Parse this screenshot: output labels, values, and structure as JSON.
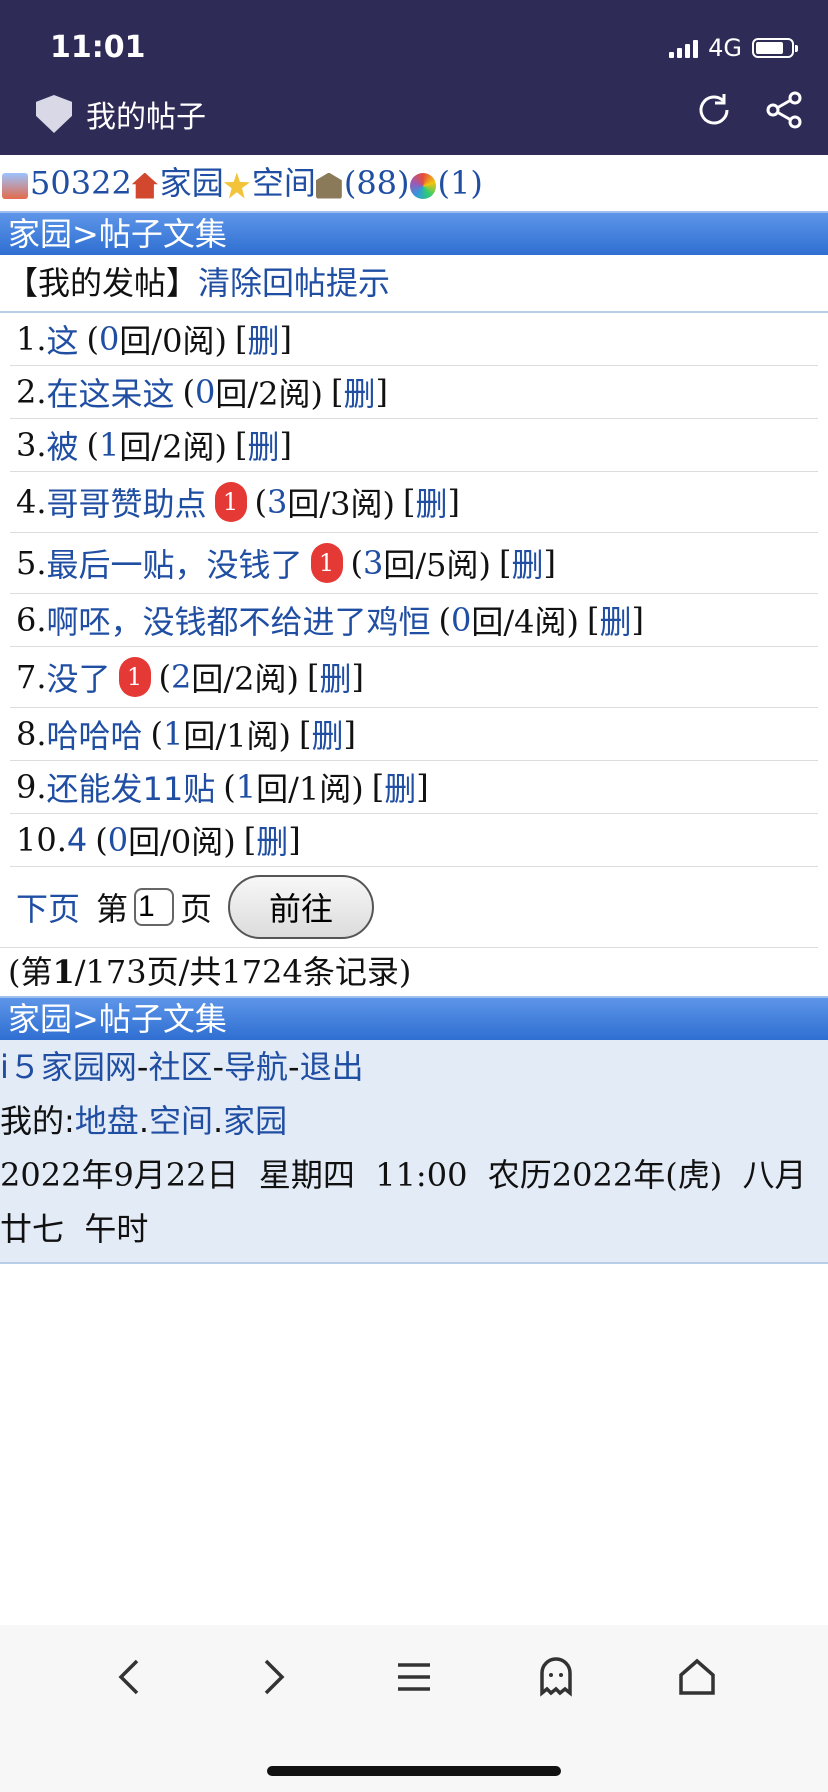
{
  "status": {
    "time": "11:01",
    "network": "4G"
  },
  "browser": {
    "title": "我的帖子"
  },
  "userbar": {
    "uid": "50322",
    "home": "家园",
    "space": "空间",
    "count1": "(88)",
    "count2": "(1)"
  },
  "breadcrumb": "家园>帖子文集",
  "subhead": {
    "mine": "【我的发帖】",
    "clear": "清除回帖提示"
  },
  "posts": [
    {
      "idx": "1.",
      "title": "这",
      "replies": "0",
      "stat": "回/0阅)",
      "badge": "",
      "del": "删"
    },
    {
      "idx": "2.",
      "title": "在这呆这",
      "replies": "0",
      "stat": "回/2阅)",
      "badge": "",
      "del": "删"
    },
    {
      "idx": "3.",
      "title": "被",
      "replies": "1",
      "stat": "回/2阅)",
      "badge": "",
      "del": "删"
    },
    {
      "idx": "4.",
      "title": "哥哥赞助点",
      "replies": "3",
      "stat": "回/3阅)",
      "badge": "1",
      "del": "删"
    },
    {
      "idx": "5.",
      "title": "最后一贴，没钱了",
      "replies": "3",
      "stat": "回/5阅)",
      "badge": "1",
      "del": "删"
    },
    {
      "idx": "6.",
      "title": "啊呸，没钱都不给进了鸡恒",
      "replies": "0",
      "stat": "回/4阅)",
      "badge": "",
      "del": "删"
    },
    {
      "idx": "7.",
      "title": "没了",
      "replies": "2",
      "stat": "回/2阅)",
      "badge": "1",
      "del": "删"
    },
    {
      "idx": "8.",
      "title": "哈哈哈",
      "replies": "1",
      "stat": "回/1阅)",
      "badge": "",
      "del": "删"
    },
    {
      "idx": "9.",
      "title": "还能发11贴",
      "replies": "1",
      "stat": "回/1阅)",
      "badge": "",
      "del": "删"
    },
    {
      "idx": "10.",
      "title": "4",
      "replies": "0",
      "stat": "回/0阅)",
      "badge": "",
      "del": "删"
    }
  ],
  "pager": {
    "next": "下页",
    "prefix": "第",
    "value": "1",
    "suffix": "页",
    "go": "前往"
  },
  "summary": {
    "open": "(第",
    "current": "1",
    "rest": "/173页/共1724条记录)"
  },
  "footer": {
    "nav": [
      "i５家园网",
      "社区",
      "导航",
      "退出"
    ],
    "my_label": "我的:",
    "my_links": [
      "地盘",
      "空间",
      "家园"
    ],
    "datetime": "2022年9月22日  星期四  11:00  农历2022年(虎)  八月廿七  午时"
  },
  "colors": {
    "topbar": "#2f2b57",
    "link": "#1f4ea3",
    "bar": "#3b7ad8",
    "badge": "#e53935"
  }
}
